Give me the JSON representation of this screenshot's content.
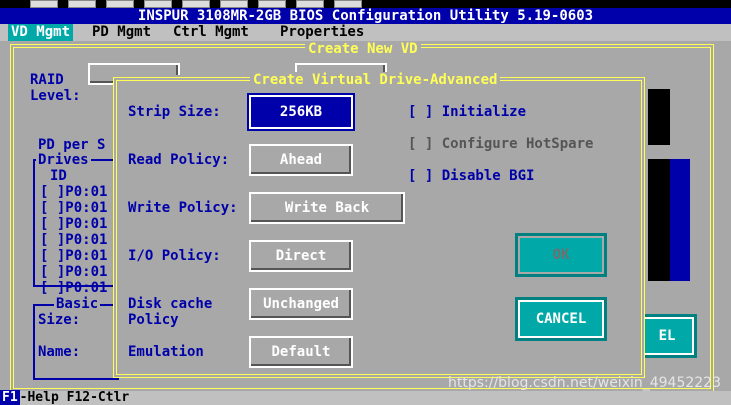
{
  "window": {
    "title": "INSPUR 3108MR-2GB BIOS Configuration Utility 5.19-0603"
  },
  "menu": {
    "items": [
      "VD Mgmt",
      "PD Mgmt",
      "Ctrl Mgmt",
      "Properties"
    ]
  },
  "background_dialog": {
    "title": "Create New VD",
    "raid_label_1": "RAID",
    "raid_label_2": "Level:",
    "pd_per_span": "PD per S",
    "drives_label": "Drives",
    "id_col": "ID",
    "drive_rows": [
      "[ ]P0:01",
      "[ ]P0:01",
      "[ ]P0:01",
      "[ ]P0:01",
      "[ ]P0:01",
      "[ ]P0:01",
      "[ ]P0:01"
    ],
    "basic_label": "Basic",
    "size_label": "Size:",
    "name_label": "Name:",
    "partial_button": "EL"
  },
  "dialog": {
    "title": "Create Virtual Drive-Advanced",
    "strip_size_label": "Strip Size:",
    "strip_size_value": "256KB",
    "read_policy_label": "Read Policy:",
    "read_policy_value": "Ahead",
    "write_policy_label": "Write Policy:",
    "write_policy_value": "Write Back",
    "io_policy_label": "I/O Policy:",
    "io_policy_value": "Direct",
    "disk_cache_label_1": "Disk cache",
    "disk_cache_label_2": "Policy",
    "disk_cache_value": "Unchanged",
    "emulation_label": "Emulation",
    "emulation_value": "Default",
    "initialize": "[ ] Initialize",
    "configure_hotspare": "[ ] Configure HotSpare",
    "disable_bgi": "[ ] Disable BGI",
    "ok": "OK",
    "cancel": "CANCEL"
  },
  "status": {
    "key": "F1",
    "text": "-Help F12-Ctlr"
  },
  "watermark": "https://blog.csdn.net/weixin_49452223"
}
